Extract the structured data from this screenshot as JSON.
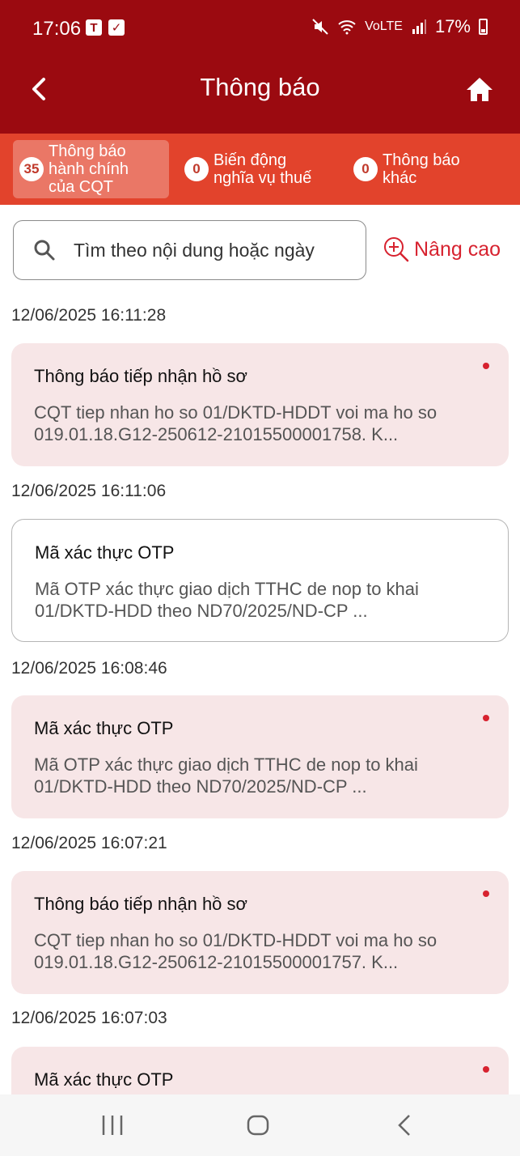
{
  "status_bar": {
    "time": "17:06",
    "battery": "17%",
    "volte": "VoLTE"
  },
  "header": {
    "title": "Thông báo"
  },
  "tabs": [
    {
      "count": "35",
      "label": "Thông báo\nhành chính\ncủa CQT"
    },
    {
      "count": "0",
      "label": "Biến động\nnghĩa vụ thuế"
    },
    {
      "count": "0",
      "label": "Thông báo\nkhác"
    }
  ],
  "search": {
    "placeholder": "Tìm theo nội dung hoặc ngày",
    "advanced_label": "Nâng cao"
  },
  "notifications": [
    {
      "timestamp": "12/06/2025 16:11:28",
      "title": "Thông báo tiếp nhận hồ sơ",
      "body": "CQT tiep nhan ho so 01/DKTD-HDDT voi ma ho so 019.01.18.G12-250612-21015500001758. K..."
    },
    {
      "timestamp": "12/06/2025 16:11:06",
      "title": "Mã xác thực OTP",
      "body": "Mã OTP xác thực giao dịch TTHC de nop to khai 01/DKTD-HDD theo ND70/2025/ND-CP ..."
    },
    {
      "timestamp": "12/06/2025 16:08:46",
      "title": "Mã xác thực OTP",
      "body": "Mã OTP xác thực giao dịch TTHC de nop to khai 01/DKTD-HDD theo ND70/2025/ND-CP ..."
    },
    {
      "timestamp": "12/06/2025 16:07:21",
      "title": "Thông báo tiếp nhận hồ sơ",
      "body": "CQT tiep nhan ho so 01/DKTD-HDDT voi ma ho so 019.01.18.G12-250612-21015500001757. K..."
    },
    {
      "timestamp": "12/06/2025 16:07:03",
      "title": "Mã xác thực OTP",
      "body": ""
    }
  ]
}
